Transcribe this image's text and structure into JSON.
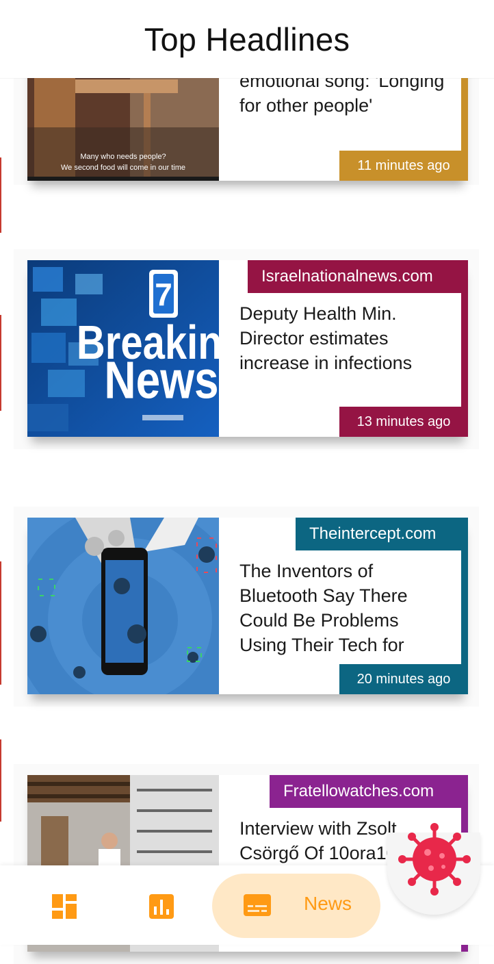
{
  "app": {
    "title": "Top Headlines"
  },
  "articles": [
    {
      "source": "",
      "headline": "emotional song: 'Longing for other people'",
      "time": "11 minutes ago",
      "accent": "#c8902a",
      "thumb_caption": "Many who needs people? We second food will come in our time"
    },
    {
      "source": "Israelnationalnews.com",
      "headline": "Deputy Health Min. Director estimates increase in infections",
      "time": "13 minutes ago",
      "accent": "#951444",
      "thumb_badge_number": "7",
      "thumb_text_line1": "Breaking",
      "thumb_text_line2": "News"
    },
    {
      "source": "Theintercept.com",
      "headline": "The Inventors of Bluetooth Say There Could Be Problems Using Their Tech for",
      "time": "20 minutes ago",
      "accent": "#0c6682"
    },
    {
      "source": "Fratellowatches.com",
      "headline": "Interview with Zsolt Csörgő Of 10ora10",
      "time": "",
      "accent": "#8b2390"
    }
  ],
  "bottom_nav": {
    "items": [
      {
        "icon": "dashboard-icon"
      },
      {
        "icon": "bar-chart-icon"
      },
      {
        "icon": "news-icon",
        "label": "News",
        "active": true
      }
    ],
    "active_color": "#ff9a14",
    "active_bg": "#ffe8c6"
  },
  "fab": {
    "icon": "virus-icon",
    "color": "#e8284a"
  }
}
